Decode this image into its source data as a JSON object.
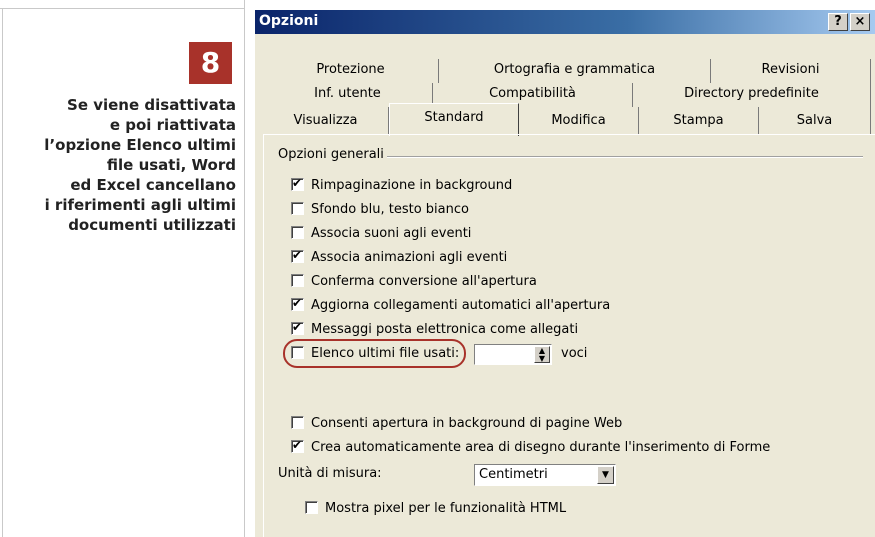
{
  "caption": {
    "step_number": "8",
    "lines": [
      "Se viene disattivata",
      "e poi riattivata",
      "l’opzione Elenco ultimi",
      "file usati, Word",
      "ed Excel cancellano",
      "i riferimenti agli ultimi",
      "documenti utilizzati"
    ]
  },
  "dialog": {
    "title": "Opzioni",
    "help_label": "?",
    "close_label": "×",
    "tabs_row1": [
      "Protezione",
      "Ortografia e grammatica",
      "Revisioni"
    ],
    "tabs_row2": [
      "Inf. utente",
      "Compatibilità",
      "Directory predefinite"
    ],
    "tabs_row3": [
      "Visualizza",
      "Standard",
      "Modifica",
      "Stampa",
      "Salva"
    ],
    "active_tab": "Standard",
    "group_label": "Opzioni generali",
    "options": [
      {
        "label": "Rimpaginazione in background",
        "checked": true
      },
      {
        "label": "Sfondo blu, testo bianco",
        "checked": false
      },
      {
        "label": "Associa suoni agli eventi",
        "checked": false
      },
      {
        "label": "Associa animazioni agli eventi",
        "checked": true
      },
      {
        "label": "Conferma conversione all'apertura",
        "checked": false
      },
      {
        "label": "Aggiorna collegamenti automatici all'apertura",
        "checked": true
      },
      {
        "label": "Messaggi posta elettronica come allegati",
        "checked": true
      },
      {
        "label": "Elenco ultimi file usati:",
        "checked": false
      },
      {
        "label": "Consenti apertura in background di pagine Web",
        "checked": false
      },
      {
        "label": "Crea automaticamente area di disegno durante l'inserimento di Forme",
        "checked": true
      }
    ],
    "recent_files_value": "",
    "recent_files_unit": "voci",
    "unit_label": "Unità di misura:",
    "unit_value": "Centimetri",
    "pixel_option": {
      "label": "Mostra pixel per le funzionalità HTML",
      "checked": false
    },
    "accent_color": "#a8322a"
  }
}
